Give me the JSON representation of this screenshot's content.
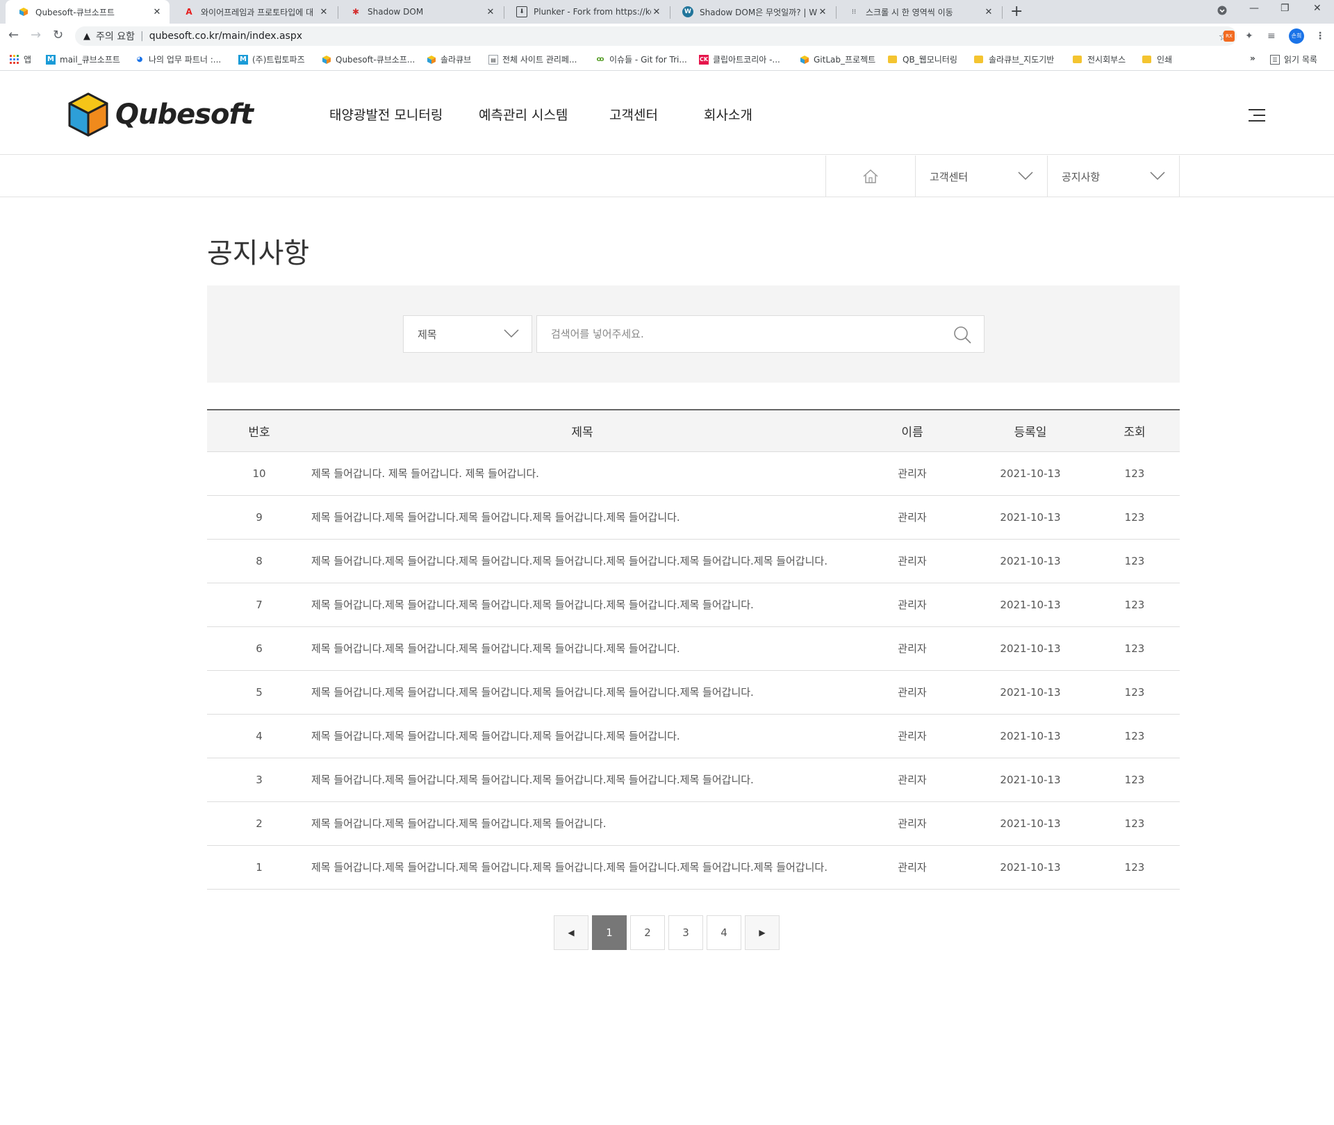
{
  "browser": {
    "tabs": [
      {
        "title": "Qubesoft-큐브소프트",
        "icon": "qubesoft-cube-icon",
        "active": true
      },
      {
        "title": "와이어프레임과 프로토타입에 대",
        "icon": "adobe-icon",
        "active": false
      },
      {
        "title": "Shadow DOM",
        "icon": "figure-icon",
        "active": false
      },
      {
        "title": "Plunker - Fork from https://ko.ja",
        "icon": "plunker-icon",
        "active": false
      },
      {
        "title": "Shadow DOM은 무엇일까? | WI",
        "icon": "wordpress-icon",
        "active": false
      },
      {
        "title": "스크롤 시 한 영역씩 이동",
        "icon": "dots-icon",
        "active": false
      }
    ],
    "security_label": "주의 요함",
    "url": "qubesoft.co.kr/main/index.aspx",
    "profile_initials": "손희",
    "extension_label": "RX",
    "bookmarks": [
      {
        "label": "앱",
        "icon": "apps-grid-icon"
      },
      {
        "label": "mail_큐브소프트",
        "icon": "m-icon"
      },
      {
        "label": "나의 업무 파트너 :...",
        "icon": "partner-icon"
      },
      {
        "label": "(주)트립토파즈",
        "icon": "m-icon"
      },
      {
        "label": "Qubesoft-큐브소프...",
        "icon": "qubesoft-cube-icon"
      },
      {
        "label": "솔라큐브",
        "icon": "qubesoft-cube-icon"
      },
      {
        "label": "전체 사이트 관리페...",
        "icon": "page-icon"
      },
      {
        "label": "이슈들 - Git for Tri...",
        "icon": "git-icon"
      },
      {
        "label": "클립아트코리아 -...",
        "icon": "ck-icon"
      },
      {
        "label": "GitLab_프로젝트",
        "icon": "qubesoft-cube-icon"
      },
      {
        "label": "QB_웹모니터링",
        "icon": "folder-icon"
      },
      {
        "label": "솔라큐브_지도기반",
        "icon": "folder-icon"
      },
      {
        "label": "전시회부스",
        "icon": "folder-icon"
      },
      {
        "label": "인쇄",
        "icon": "folder-icon"
      }
    ],
    "reading_list": "읽기 목록",
    "more": "»"
  },
  "site": {
    "logo_text": "Qubesoft",
    "gnb": [
      "태양광발전 모니터링",
      "예측관리 시스템",
      "고객센터",
      "회사소개"
    ]
  },
  "breadcrumb": {
    "level1": "고객센터",
    "level2": "공지사항"
  },
  "page": {
    "title": "공지사항"
  },
  "search": {
    "select_value": "제목",
    "placeholder": "검색어를 넣어주세요."
  },
  "board": {
    "headers": {
      "no": "번호",
      "title": "제목",
      "name": "이름",
      "date": "등록일",
      "views": "조회"
    },
    "rows": [
      {
        "no": "10",
        "title": "제목 들어갑니다. 제목 들어갑니다. 제목 들어갑니다.",
        "name": "관리자",
        "date": "2021-10-13",
        "views": "123"
      },
      {
        "no": "9",
        "title": "제목 들어갑니다.제목 들어갑니다.제목 들어갑니다.제목 들어갑니다.제목 들어갑니다.",
        "name": "관리자",
        "date": "2021-10-13",
        "views": "123"
      },
      {
        "no": "8",
        "title": "제목 들어갑니다.제목 들어갑니다.제목 들어갑니다.제목 들어갑니다.제목 들어갑니다.제목 들어갑니다.제목 들어갑니다.",
        "name": "관리자",
        "date": "2021-10-13",
        "views": "123"
      },
      {
        "no": "7",
        "title": "제목 들어갑니다.제목 들어갑니다.제목 들어갑니다.제목 들어갑니다.제목 들어갑니다.제목 들어갑니다.",
        "name": "관리자",
        "date": "2021-10-13",
        "views": "123"
      },
      {
        "no": "6",
        "title": "제목 들어갑니다.제목 들어갑니다.제목 들어갑니다.제목 들어갑니다.제목 들어갑니다.",
        "name": "관리자",
        "date": "2021-10-13",
        "views": "123"
      },
      {
        "no": "5",
        "title": "제목 들어갑니다.제목 들어갑니다.제목 들어갑니다.제목 들어갑니다.제목 들어갑니다.제목 들어갑니다.",
        "name": "관리자",
        "date": "2021-10-13",
        "views": "123"
      },
      {
        "no": "4",
        "title": "제목 들어갑니다.제목 들어갑니다.제목 들어갑니다.제목 들어갑니다.제목 들어갑니다.",
        "name": "관리자",
        "date": "2021-10-13",
        "views": "123"
      },
      {
        "no": "3",
        "title": "제목 들어갑니다.제목 들어갑니다.제목 들어갑니다.제목 들어갑니다.제목 들어갑니다.제목 들어갑니다.",
        "name": "관리자",
        "date": "2021-10-13",
        "views": "123"
      },
      {
        "no": "2",
        "title": "제목 들어갑니다.제목 들어갑니다.제목 들어갑니다.제목 들어갑니다.",
        "name": "관리자",
        "date": "2021-10-13",
        "views": "123"
      },
      {
        "no": "1",
        "title": "제목 들어갑니다.제목 들어갑니다.제목 들어갑니다.제목 들어갑니다.제목 들어갑니다.제목 들어갑니다.제목 들어갑니다.",
        "name": "관리자",
        "date": "2021-10-13",
        "views": "123"
      }
    ]
  },
  "pagination": {
    "prev": "◀",
    "next": "▶",
    "pages": [
      "1",
      "2",
      "3",
      "4"
    ],
    "current": "1"
  },
  "colors": {
    "header_border": "#666666",
    "active_page": "#777777",
    "search_bg": "#f4f4f4"
  }
}
